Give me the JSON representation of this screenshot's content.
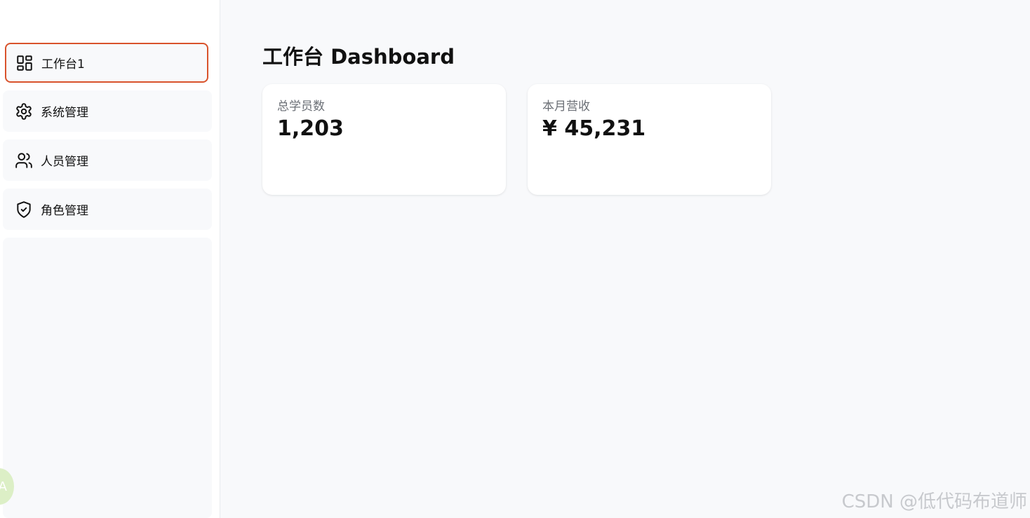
{
  "sidebar": {
    "items": [
      {
        "label": "工作台1",
        "icon": "dashboard-grid-icon",
        "active": true
      },
      {
        "label": "系统管理",
        "icon": "gear-icon",
        "active": false
      },
      {
        "label": "人员管理",
        "icon": "users-icon",
        "active": false
      },
      {
        "label": "角色管理",
        "icon": "shield-check-icon",
        "active": false
      }
    ],
    "floating_badge": "A"
  },
  "main": {
    "title": "工作台 Dashboard",
    "cards": [
      {
        "label": "总学员数",
        "value": "1,203"
      },
      {
        "label": "本月营收",
        "value": "¥ 45,231"
      }
    ]
  },
  "watermark": "CSDN @低代码布道师",
  "colors": {
    "active_border": "#d9532c",
    "page_background": "#f8f9fb",
    "card_background": "#ffffff",
    "muted_text": "#6b6f76"
  }
}
